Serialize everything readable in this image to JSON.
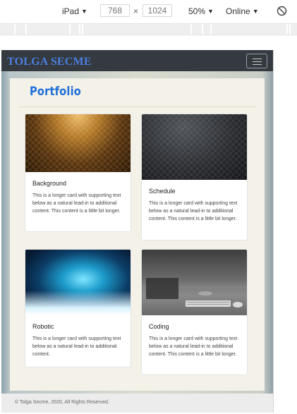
{
  "devtools": {
    "device": "iPad",
    "width": "768",
    "times": "×",
    "height": "1024",
    "zoom": "50%",
    "throttle": "Online",
    "caret": "▼"
  },
  "site": {
    "brand": "TOLGA SECME",
    "section_title": "Portfolio",
    "cards": [
      {
        "title": "Background",
        "text": "This is a longer card with supporting text below as a natural lead-in to additional content. This content is a little bit longer.",
        "image": "golden-texture-image"
      },
      {
        "title": "Schedule",
        "text": "This is a longer card with supporting text below as a natural lead-in to additional content. This content is a little bit longer.",
        "image": "dark-metal-texture-image"
      },
      {
        "title": "Robotic",
        "text": "This is a longer card with supporting text below as a natural lead-in to additional content.",
        "image": "digital-brain-image"
      },
      {
        "title": "Coding",
        "text": "This is a longer card with supporting text below as a natural lead-in to additional content. This content is a little bit longer.",
        "image": "desk-keyboard-image"
      }
    ],
    "footer": "© Tolga Secme, 2020, All Rights Reserved."
  },
  "colors": {
    "navbar": "#343a40",
    "brand": "#4a7fe0",
    "section_title": "#1e6fd9"
  }
}
